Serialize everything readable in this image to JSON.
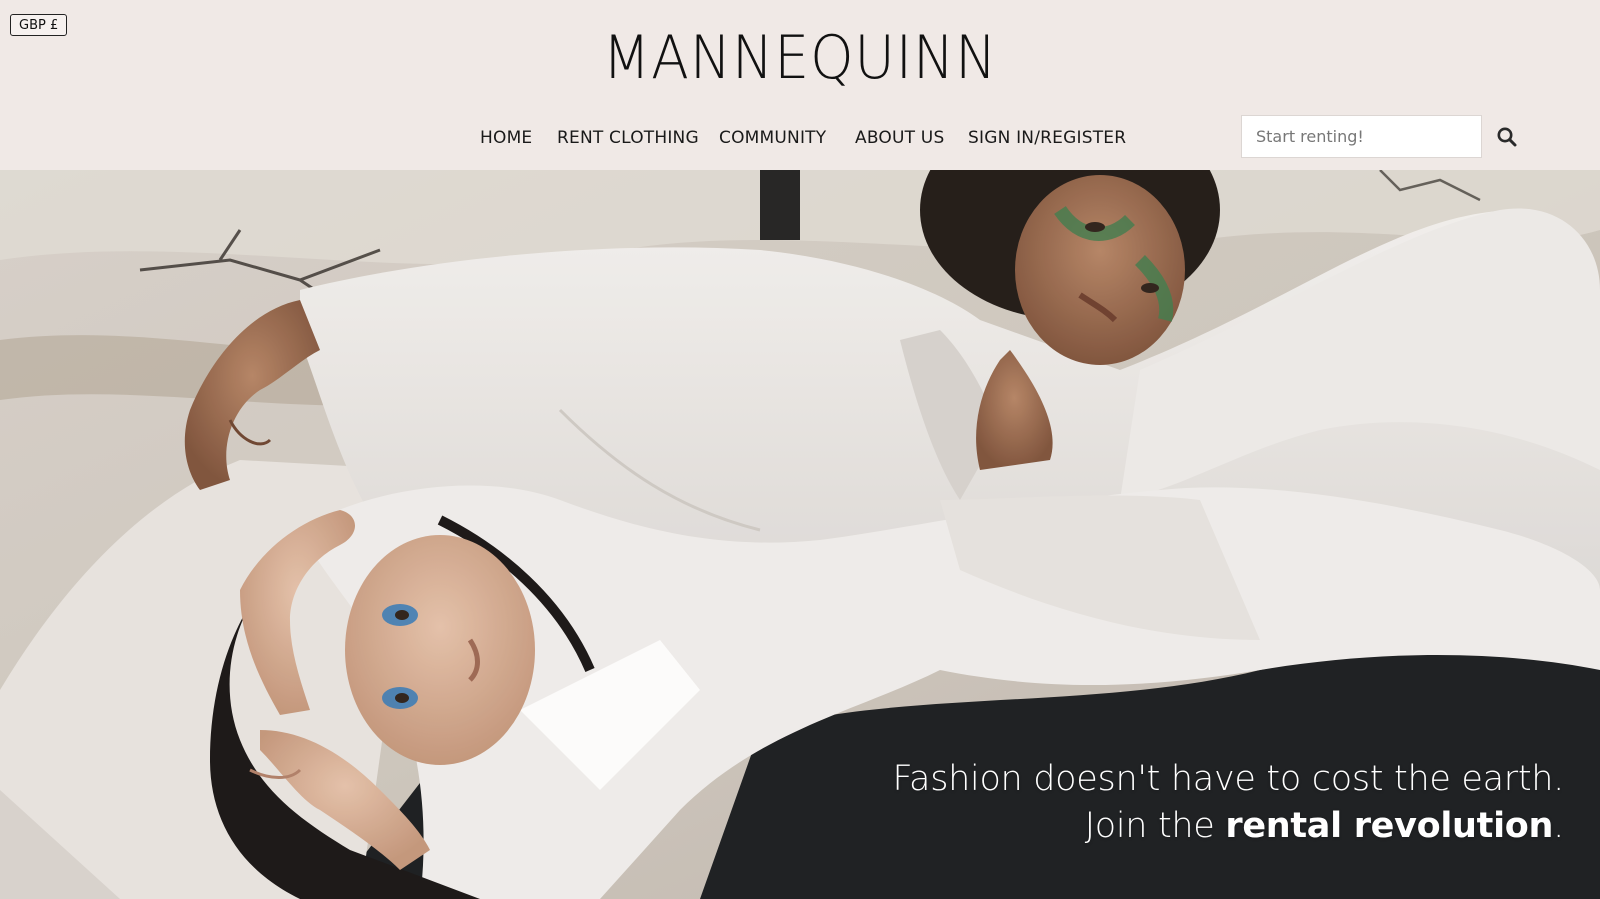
{
  "currency": {
    "label": "GBP £"
  },
  "brand": {
    "name": "MANNEQUINN"
  },
  "nav": {
    "items": [
      {
        "label": "HOME"
      },
      {
        "label": "RENT CLOTHING"
      },
      {
        "label": "COMMUNITY"
      },
      {
        "label": "ABOUT US"
      },
      {
        "label": "SIGN IN/REGISTER"
      }
    ]
  },
  "search": {
    "placeholder": "Start renting!",
    "value": ""
  },
  "hero": {
    "tagline_line1": "Fashion doesn't have to cost the earth.",
    "tagline_line2_prefix": "Join the ",
    "tagline_line2_emphasis": "rental revolution",
    "tagline_line2_suffix": "."
  },
  "icons": {
    "search": "search-icon"
  },
  "colors": {
    "header_bg": "#f0e9e6",
    "text": "#111111",
    "tagline": "#ffffff"
  }
}
